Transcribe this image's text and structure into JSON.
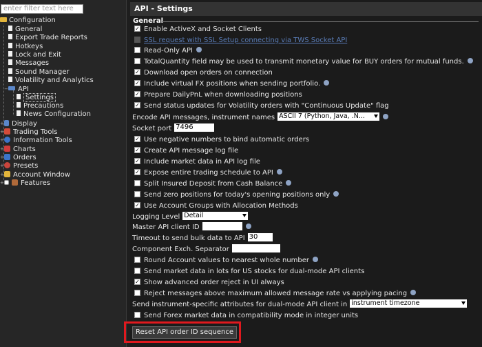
{
  "filter": {
    "placeholder": "enter filter text here"
  },
  "tree": {
    "root": "Configuration",
    "items": [
      "General",
      "Export Trade Reports",
      "Hotkeys",
      "Lock and Exit",
      "Messages",
      "Sound Manager",
      "Volatility and Analytics",
      "API"
    ],
    "api_children": [
      "Settings",
      "Precautions",
      "News Configuration"
    ],
    "bottom": [
      "Display",
      "Trading Tools",
      "Information Tools",
      "Charts",
      "Orders",
      "Presets",
      "Account Window",
      "Features"
    ]
  },
  "header": {
    "title": "API - Settings",
    "section": "General"
  },
  "settings": {
    "activex": "Enable ActiveX and Socket Clients",
    "ssl": "SSL request with SSL Setup connecting via TWS Socket API",
    "readonly": "Read-Only API",
    "totalqty": "TotalQuantity field may be used to transmit monetary value for BUY orders for mutual funds.",
    "download_open": "Download open orders on connection",
    "virtual_fx": "Include virtual FX positions when sending portfolio.",
    "dailypnl": "Prepare DailyPnL when downloading positions",
    "vol_updates": "Send status updates for Volatility orders with \"Continuous Update\" flag",
    "encode_label": "Encode API messages, instrument names",
    "encode_value": "ASCII 7 (Python, Java, .N...",
    "socket_label": "Socket port",
    "socket_value": "7496",
    "neg_numbers": "Use negative numbers to bind automatic orders",
    "create_log": "Create API message log file",
    "market_log": "Include market data in API log file",
    "expose_schedule": "Expose entire trading schedule to API",
    "split_deposit": "Split Insured Deposit from Cash Balance",
    "zero_positions": "Send zero positions for today's opening positions only",
    "account_groups": "Use Account Groups with Allocation Methods",
    "logging_label": "Logging Level",
    "logging_value": "Detail",
    "master_label": "Master API client ID",
    "master_value": "",
    "timeout_label": "Timeout to send bulk data to API",
    "timeout_value": "30",
    "separator_label": "Component Exch. Separator",
    "separator_value": "",
    "round_account": "Round Account values to nearest whole number",
    "lots": "Send market data in lots for US stocks for dual-mode API clients",
    "adv_reject": "Show advanced order reject in UI always",
    "reject_msgs": "Reject messages above maximum allowed message rate vs applying pacing",
    "instr_attr_label": "Send instrument-specific attributes for dual-mode API client in",
    "instr_attr_value": "instrument timezone",
    "forex_int": "Send Forex market data in compatibility mode in integer units"
  },
  "reset_button": "Reset API order ID sequence"
}
